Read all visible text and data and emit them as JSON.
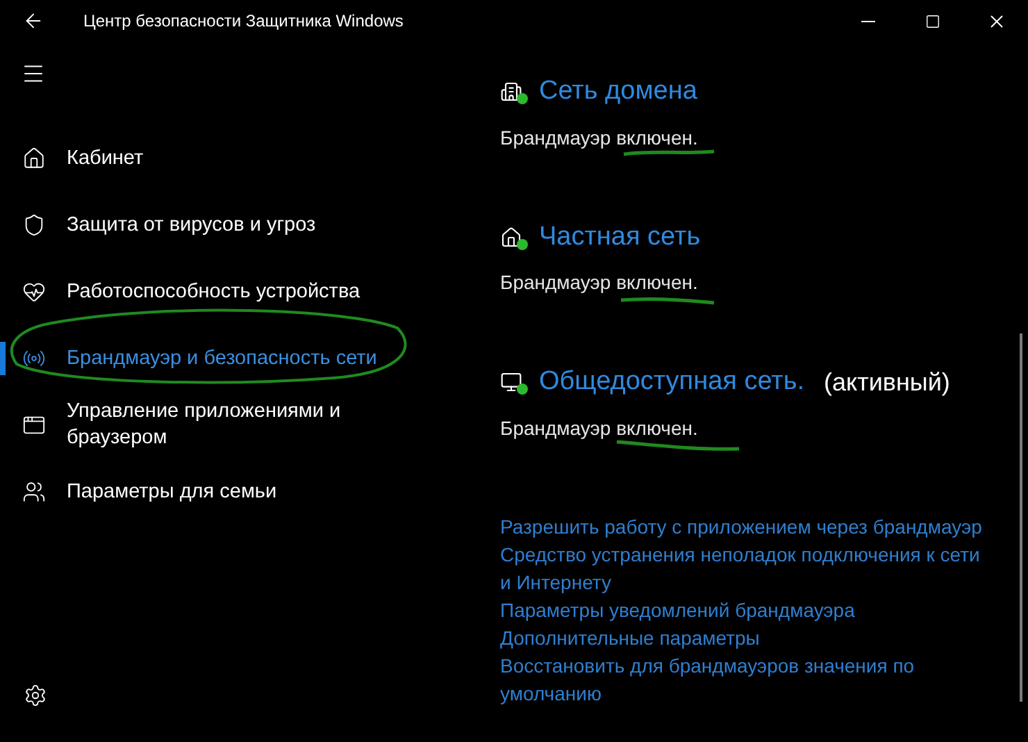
{
  "window": {
    "title": "Центр безопасности Защитника Windows"
  },
  "sidebar": {
    "items": [
      {
        "label": "Кабинет",
        "kind": "home",
        "selected": false
      },
      {
        "label": "Защита от вирусов и угроз",
        "kind": "shield",
        "selected": false
      },
      {
        "label": "Работоспособность устройства",
        "kind": "heart",
        "selected": false
      },
      {
        "label": "Брандмауэр и безопасность сети",
        "kind": "antenna",
        "selected": true
      },
      {
        "label": "Управление приложениями и браузером",
        "kind": "window",
        "selected": false
      },
      {
        "label": "Параметры для семьи",
        "kind": "family",
        "selected": false
      }
    ]
  },
  "networks": [
    {
      "name": "Сеть домена",
      "kind": "domain",
      "status": "Брандмауэр включен."
    },
    {
      "name": "Частная сеть",
      "kind": "private",
      "status": "Брандмауэр включен."
    },
    {
      "name": "Общедоступная сеть.",
      "kind": "public",
      "badge": "(активный)",
      "status": "Брандмауэр включен."
    }
  ],
  "links": [
    "Разрешить работу с приложением через брандмауэр",
    "Средство устранения неполадок подключения к сети и Интернету",
    "Параметры уведомлений брандмауэра",
    "Дополнительные параметры",
    "Восстановить для брандмауэров значения по умолчанию"
  ]
}
